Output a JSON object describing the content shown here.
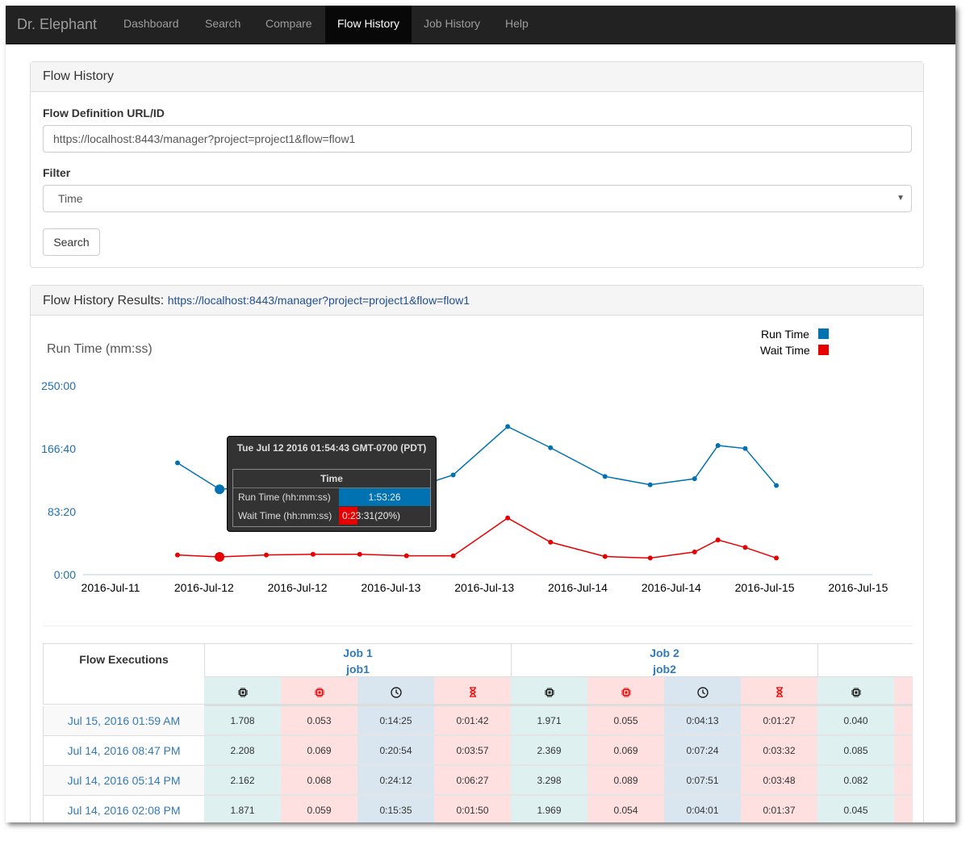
{
  "navbar": {
    "brand": "Dr. Elephant",
    "items": [
      {
        "label": "Dashboard"
      },
      {
        "label": "Search"
      },
      {
        "label": "Compare"
      },
      {
        "label": "Flow History",
        "active": true
      },
      {
        "label": "Job History"
      },
      {
        "label": "Help"
      }
    ]
  },
  "form": {
    "title": "Flow History",
    "url_label": "Flow Definition URL/ID",
    "url_value": "https://localhost:8443/manager?project=project1&flow=flow1",
    "filter_label": "Filter",
    "filter_value": "Time",
    "search_button": "Search"
  },
  "results": {
    "title": "Flow History Results:",
    "link": "https://localhost:8443/manager?project=project1&flow=flow1"
  },
  "chart_data": {
    "type": "line",
    "ylabel": "Run Time (mm:ss)",
    "y_ticks": [
      "250:00",
      "166:40",
      "83:20",
      "0:00"
    ],
    "ylim_minutes": [
      0,
      250
    ],
    "x_ticks": [
      "2016-Jul-11",
      "2016-Jul-12",
      "2016-Jul-12",
      "2016-Jul-13",
      "2016-Jul-13",
      "2016-Jul-14",
      "2016-Jul-14",
      "2016-Jul-15",
      "2016-Jul-15"
    ],
    "x_tick_hours": [
      0,
      12,
      24,
      36,
      48,
      60,
      72,
      84,
      96
    ],
    "legend_position": "top-right",
    "series": [
      {
        "name": "Run Time",
        "color": "#0072b2",
        "x_hours": [
          8.6,
          14,
          20,
          26,
          32,
          38,
          44,
          51,
          56.5,
          63.5,
          69.3,
          75,
          78,
          81.5,
          85.5
        ],
        "values": [
          148,
          113,
          117,
          126,
          132,
          112,
          132,
          196,
          168,
          130,
          119,
          127,
          171,
          167,
          118
        ]
      },
      {
        "name": "Wait Time",
        "color": "#e60000",
        "x_hours": [
          8.6,
          14,
          20,
          26,
          32,
          38,
          44,
          51,
          56.5,
          63.5,
          69.3,
          75,
          78,
          81.5,
          85.5
        ],
        "values": [
          26,
          23.5,
          26,
          27,
          27,
          25,
          25,
          75,
          43,
          24,
          22,
          30,
          46,
          36,
          22
        ]
      }
    ],
    "highlight_index": 1
  },
  "tooltip": {
    "title": "Tue Jul 12 2016 01:54:43 GMT-0700 (PDT)",
    "header": "Time",
    "run_label": "Run Time (hh:mm:ss)",
    "run_value": "1:53:26",
    "run_fraction": 1.0,
    "wait_label": "Wait Time (hh:mm:ss)",
    "wait_value": "0:23:31(20%)",
    "wait_fraction": 0.2,
    "run_color": "#0072b2",
    "wait_color": "#e60000"
  },
  "table": {
    "first_header": "Flow Executions",
    "jobs": [
      {
        "name": "Job 1",
        "id": "job1"
      },
      {
        "name": "Job 2",
        "id": "job2"
      }
    ],
    "column_icons": [
      "cpu-icon",
      "cpu-waste-icon",
      "clock-icon",
      "hourglass-icon"
    ],
    "rows": [
      {
        "date": "Jul 15, 2016 01:59 AM",
        "values": [
          "1.708",
          "0.053",
          "0:14:25",
          "0:01:42",
          "1.971",
          "0.055",
          "0:04:13",
          "0:01:27",
          "0.040"
        ]
      },
      {
        "date": "Jul 14, 2016 08:47 PM",
        "values": [
          "2.208",
          "0.069",
          "0:20:54",
          "0:03:57",
          "2.369",
          "0.069",
          "0:07:24",
          "0:03:32",
          "0.085"
        ]
      },
      {
        "date": "Jul 14, 2016 05:14 PM",
        "values": [
          "2.162",
          "0.068",
          "0:24:12",
          "0:06:27",
          "3.298",
          "0.089",
          "0:07:51",
          "0:03:48",
          "0.082"
        ]
      },
      {
        "date": "Jul 14, 2016 02:08 PM",
        "values": [
          "1.871",
          "0.059",
          "0:15:35",
          "0:01:50",
          "1.969",
          "0.054",
          "0:04:01",
          "0:01:37",
          "0.045"
        ]
      }
    ]
  }
}
